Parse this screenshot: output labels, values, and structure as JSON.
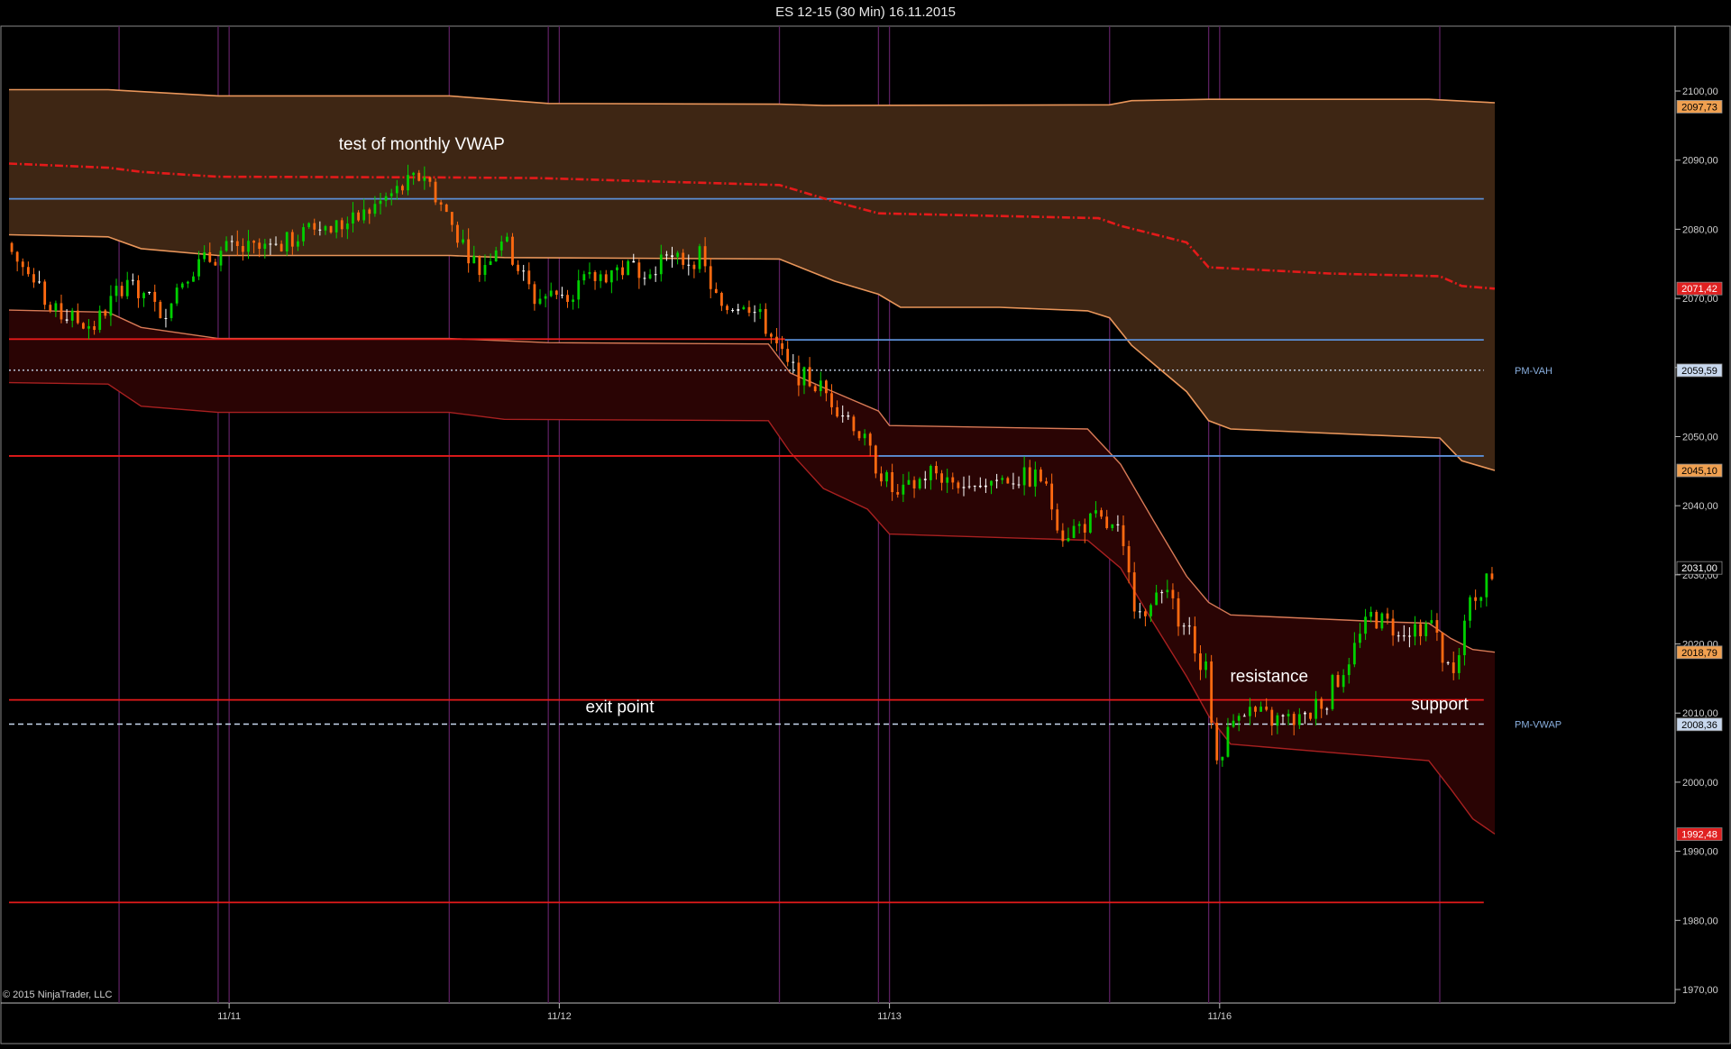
{
  "title": "ES 12-15 (30 Min)  16.11.2015",
  "copyright": "© 2015 NinjaTrader, LLC",
  "chart_data": {
    "type": "candlestick",
    "title": "ES 12-15 (30 Min)  16.11.2015",
    "ylim": [
      1965,
      2105
    ],
    "y_ticks": [
      {
        "v": 2100,
        "label": "2100,00"
      },
      {
        "v": 2090,
        "label": "2090,00"
      },
      {
        "v": 2080,
        "label": "2080,00"
      },
      {
        "v": 2070,
        "label": "2070,00"
      },
      {
        "v": 2060,
        "label": "2060,00"
      },
      {
        "v": 2050,
        "label": "2050,00"
      },
      {
        "v": 2040,
        "label": "2040,00"
      },
      {
        "v": 2030,
        "label": "2030,00"
      },
      {
        "v": 2020,
        "label": "2020,00"
      },
      {
        "v": 2010,
        "label": "2010,00"
      },
      {
        "v": 2000,
        "label": "2000,00"
      },
      {
        "v": 1990,
        "label": "1990,00"
      },
      {
        "v": 1980,
        "label": "1980,00"
      },
      {
        "v": 1970,
        "label": "1970,00"
      }
    ],
    "x_ticks": [
      {
        "bar": 40,
        "label": "11/11"
      },
      {
        "bar": 100,
        "label": "11/12"
      },
      {
        "bar": 160,
        "label": "11/13"
      },
      {
        "bar": 220,
        "label": "11/16"
      }
    ],
    "session_lines": [
      20,
      38,
      40,
      80,
      98,
      100,
      140,
      158,
      160,
      200,
      218,
      220,
      260
    ],
    "bar_count": 270,
    "upper_band": {
      "upper": [
        [
          0,
          2100.2
        ],
        [
          18,
          2100.2
        ],
        [
          38,
          2099.3
        ],
        [
          80,
          2099.3
        ],
        [
          98,
          2098.2
        ],
        [
          140,
          2098.1
        ],
        [
          148,
          2097.9
        ],
        [
          200,
          2098
        ],
        [
          204,
          2098.6
        ],
        [
          218,
          2098.8
        ],
        [
          258,
          2098.8
        ],
        [
          270,
          2098.3
        ]
      ],
      "lower": [
        [
          0,
          2079.2
        ],
        [
          18,
          2078.9
        ],
        [
          24,
          2077.2
        ],
        [
          38,
          2076.2
        ],
        [
          80,
          2076.2
        ],
        [
          90,
          2075.9
        ],
        [
          140,
          2075.7
        ],
        [
          150,
          2072.5
        ],
        [
          158,
          2070.6
        ],
        [
          162,
          2068.7
        ],
        [
          180,
          2068.7
        ],
        [
          196,
          2068.2
        ],
        [
          200,
          2067.2
        ],
        [
          204,
          2063.2
        ],
        [
          214,
          2056.5
        ],
        [
          218,
          2052.3
        ],
        [
          222,
          2051.1
        ],
        [
          260,
          2049.8
        ],
        [
          264,
          2046.5
        ],
        [
          270,
          2045.1
        ]
      ]
    },
    "lower_band": {
      "upper": [
        [
          0,
          2068.3
        ],
        [
          18,
          2068
        ],
        [
          24,
          2065.8
        ],
        [
          38,
          2064.2
        ],
        [
          80,
          2064.2
        ],
        [
          98,
          2063.6
        ],
        [
          138,
          2063.4
        ],
        [
          142,
          2059.2
        ],
        [
          148,
          2057.1
        ],
        [
          158,
          2053.7
        ],
        [
          160,
          2051.6
        ],
        [
          196,
          2051.1
        ],
        [
          202,
          2046
        ],
        [
          208,
          2037.8
        ],
        [
          214,
          2029.8
        ],
        [
          218,
          2026
        ],
        [
          222,
          2024.2
        ],
        [
          250,
          2023.2
        ],
        [
          258,
          2023
        ],
        [
          262,
          2020.8
        ],
        [
          266,
          2019.2
        ],
        [
          270,
          2018.8
        ]
      ],
      "lower": [
        [
          0,
          2057.8
        ],
        [
          18,
          2057.6
        ],
        [
          24,
          2054.4
        ],
        [
          38,
          2053.5
        ],
        [
          80,
          2053.5
        ],
        [
          90,
          2052.5
        ],
        [
          138,
          2052.3
        ],
        [
          142,
          2047.7
        ],
        [
          148,
          2042.5
        ],
        [
          156,
          2039.5
        ],
        [
          160,
          2035.9
        ],
        [
          196,
          2035
        ],
        [
          202,
          2031
        ],
        [
          208,
          2023
        ],
        [
          214,
          2015.3
        ],
        [
          218,
          2009.6
        ],
        [
          222,
          2005.5
        ],
        [
          258,
          2003.1
        ],
        [
          262,
          1999
        ],
        [
          266,
          1994.7
        ],
        [
          270,
          1992.5
        ]
      ]
    },
    "monthly_vwap": [
      [
        0,
        2089.5
      ],
      [
        18,
        2088.9
      ],
      [
        24,
        2088.3
      ],
      [
        38,
        2087.6
      ],
      [
        80,
        2087.5
      ],
      [
        96,
        2087.4
      ],
      [
        140,
        2086.4
      ],
      [
        150,
        2084
      ],
      [
        158,
        2082.3
      ],
      [
        198,
        2081.6
      ],
      [
        202,
        2080.5
      ],
      [
        214,
        2078.1
      ],
      [
        218,
        2074.5
      ],
      [
        240,
        2073.6
      ],
      [
        260,
        2073.2
      ],
      [
        264,
        2071.8
      ],
      [
        270,
        2071.4
      ]
    ],
    "h_lines": [
      {
        "name": "blue-1",
        "y": 2084.4,
        "from": 0,
        "to": 268,
        "color": "#5b8fd6"
      },
      {
        "name": "blue-2",
        "y": 2064,
        "from": 141,
        "to": 268,
        "color": "#5b8fd6"
      },
      {
        "name": "blue-3",
        "y": 2047.2,
        "from": 158,
        "to": 268,
        "color": "#5b8fd6"
      },
      {
        "name": "red-1",
        "y": 2064.1,
        "from": 0,
        "to": 141,
        "color": "#e41a1a"
      },
      {
        "name": "red-2",
        "y": 2047.2,
        "from": 0,
        "to": 158,
        "color": "#e41a1a"
      },
      {
        "name": "red-3",
        "y": 2011.9,
        "from": 0,
        "to": 268,
        "color": "#e41a1a"
      },
      {
        "name": "red-4",
        "y": 1982.6,
        "from": 0,
        "to": 268,
        "color": "#e41a1a"
      }
    ],
    "dotted_lines": [
      {
        "name": "pm-vah",
        "y": 2059.6,
        "label": "PM-VAH",
        "style": "dotted"
      },
      {
        "name": "pm-vwap",
        "y": 2008.4,
        "label": "PM-VWAP",
        "style": "dashed"
      }
    ],
    "price_tags": [
      {
        "y": 2097.73,
        "label": "2097,73",
        "bg": "#f0a050",
        "fg": "#000"
      },
      {
        "y": 2071.42,
        "label": "2071,42",
        "bg": "#e02020",
        "fg": "#fff"
      },
      {
        "y": 2059.59,
        "label": "2059,59",
        "bg": "#c8d8ee",
        "fg": "#000"
      },
      {
        "y": 2045.1,
        "label": "2045,10",
        "bg": "#f0a050",
        "fg": "#000"
      },
      {
        "y": 2031.0,
        "label": "2031,00",
        "bg": "#000",
        "fg": "#fff"
      },
      {
        "y": 2018.79,
        "label": "2018,79",
        "bg": "#f0a050",
        "fg": "#000"
      },
      {
        "y": 2008.36,
        "label": "2008,36",
        "bg": "#c8d8ee",
        "fg": "#000"
      },
      {
        "y": 1992.48,
        "label": "1992,48",
        "bg": "#e02020",
        "fg": "#fff"
      }
    ],
    "annotations": [
      {
        "text": "test of monthly VWAP",
        "bar": 75,
        "y": 2091.5
      },
      {
        "text": "exit point",
        "bar": 111,
        "y": 2010.1
      },
      {
        "text": "resistance",
        "bar": 229,
        "y": 2014.5
      },
      {
        "text": "support",
        "bar": 260,
        "y": 2010.5
      }
    ],
    "price_path": [
      [
        0,
        2078
      ],
      [
        8,
        2068
      ],
      [
        16,
        2066
      ],
      [
        22,
        2073
      ],
      [
        28,
        2068
      ],
      [
        33,
        2074
      ],
      [
        40,
        2077
      ],
      [
        48,
        2077
      ],
      [
        56,
        2080
      ],
      [
        63,
        2081
      ],
      [
        70,
        2085
      ],
      [
        76,
        2088
      ],
      [
        80,
        2082
      ],
      [
        86,
        2074
      ],
      [
        90,
        2079
      ],
      [
        96,
        2070
      ],
      [
        102,
        2071
      ],
      [
        110,
        2074
      ],
      [
        120,
        2075
      ],
      [
        126,
        2076
      ],
      [
        130,
        2068
      ],
      [
        134,
        2070
      ],
      [
        138,
        2066
      ],
      [
        142,
        2060
      ],
      [
        148,
        2057
      ],
      [
        154,
        2052
      ],
      [
        158,
        2046
      ],
      [
        162,
        2041
      ],
      [
        168,
        2045
      ],
      [
        174,
        2043
      ],
      [
        182,
        2044
      ],
      [
        188,
        2044
      ],
      [
        192,
        2036
      ],
      [
        198,
        2038
      ],
      [
        202,
        2036
      ],
      [
        206,
        2023
      ],
      [
        210,
        2031
      ],
      [
        214,
        2020
      ],
      [
        218,
        2016
      ],
      [
        220,
        2003
      ],
      [
        224,
        2011
      ],
      [
        230,
        2009
      ],
      [
        236,
        2009
      ],
      [
        242,
        2015
      ],
      [
        248,
        2024
      ],
      [
        253,
        2022
      ],
      [
        259,
        2023
      ],
      [
        262,
        2016
      ],
      [
        264,
        2018
      ],
      [
        266,
        2026
      ],
      [
        270,
        2030
      ]
    ],
    "candle_colors": {
      "up": "#00d000",
      "down": "#ff6a10",
      "doji": "#ffffff"
    }
  }
}
